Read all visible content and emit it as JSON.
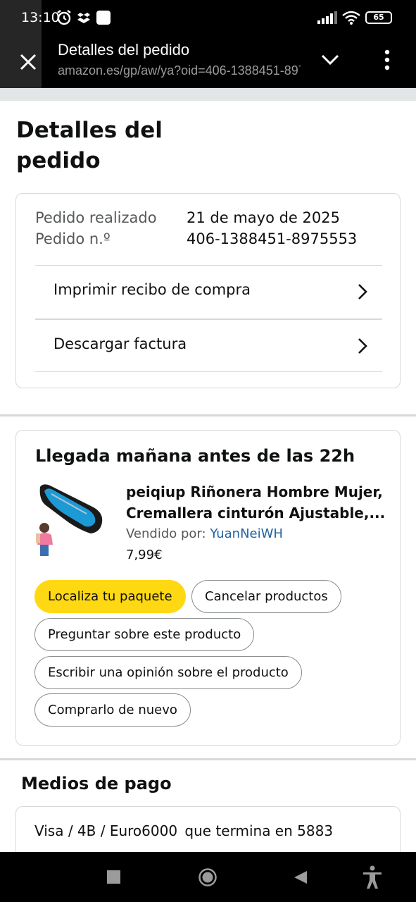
{
  "status_bar": {
    "time": "13:10",
    "battery": "65",
    "icons": [
      "alarm-icon",
      "dropbox-icon",
      "notification-square-icon",
      "signal-icon",
      "wifi-icon",
      "battery-icon"
    ]
  },
  "tab": {
    "title": "Detalles del pedido",
    "url": "amazon.es/gp/aw/ya?oid=406-1388451-8975553"
  },
  "page": {
    "title_line1": "Detalles del",
    "title_line2": "pedido"
  },
  "order_info": {
    "placed_label": "Pedido realizado",
    "placed_value": "21 de mayo de 2025",
    "number_label": "Pedido n.º",
    "number_value": "406-1388451-8975553",
    "links": [
      {
        "label": "Imprimir recibo de compra"
      },
      {
        "label": "Descargar factura"
      }
    ]
  },
  "shipment": {
    "title": "Llegada mañana antes de las 22h",
    "product_line1": "peiqiup Riñonera Hombre Mujer,",
    "product_line2": "Cremallera cinturón Ajustable,...",
    "seller_label": "Vendido por:",
    "seller_name": "YuanNeiWH",
    "price": "7,99€",
    "actions": {
      "track": "Localiza tu paquete",
      "cancel": "Cancelar productos",
      "ask": "Preguntar sobre este producto",
      "review": "Escribir una opinión sobre el producto",
      "buy_again": "Comprarlo de nuevo"
    }
  },
  "payment": {
    "title": "Medios de pago",
    "method": "Visa / 4B / Euro6000",
    "ending": "que termina en 5883"
  },
  "colors": {
    "primary_button": "#ffd814",
    "link": "#2162a1",
    "divider": "#d5d9d9"
  }
}
